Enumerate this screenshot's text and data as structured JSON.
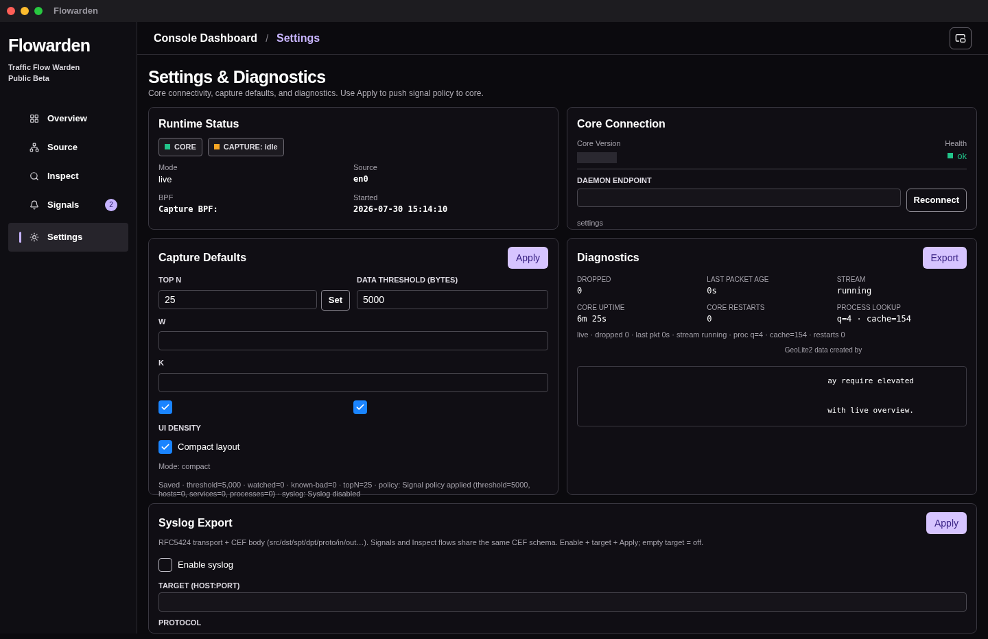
{
  "window": {
    "title": "Flowarden"
  },
  "sidebar": {
    "brand": "Flowarden",
    "tagline": "Traffic Flow Warden",
    "edition": "Public Beta",
    "items": [
      {
        "label": "Overview",
        "selected": false
      },
      {
        "label": "Source",
        "selected": false
      },
      {
        "label": "Inspect",
        "selected": false
      },
      {
        "label": "Signals",
        "selected": false,
        "badge": "2"
      },
      {
        "label": "Settings",
        "selected": true
      }
    ]
  },
  "breadcrumb": {
    "parent": "Console Dashboard",
    "separator": "/",
    "current": "Settings"
  },
  "page": {
    "title": "Settings & Diagnostics",
    "subtitle": "Core connectivity, capture defaults, and diagnostics. Use Apply to push signal policy to core."
  },
  "runtime_status": {
    "title": "Runtime Status",
    "badges": [
      {
        "label": "CORE",
        "color": "#22c48a"
      },
      {
        "label": "CAPTURE: idle",
        "color": "#f5a524"
      }
    ],
    "fields": [
      {
        "label": "Mode",
        "value": "live",
        "mono": false
      },
      {
        "label": "Source",
        "value": "en0",
        "mono": true
      },
      {
        "label": "BPF",
        "value": "Capture BPF:",
        "mono": true
      },
      {
        "label": "Started",
        "value": "2026-07-30 15:14:10",
        "mono": true
      }
    ]
  },
  "core_connection": {
    "title": "Core Connection",
    "version_label": "Core Version",
    "health_label": "Health",
    "health_value": "ok",
    "endpoint_label": "DAEMON ENDPOINT",
    "reconnect": "Reconnect",
    "note": "settings"
  },
  "capture_defaults": {
    "title": "Capture Defaults",
    "apply": "Apply",
    "top_n_label": "TOP N",
    "top_n_value": "25",
    "set": "Set",
    "threshold_label": "DATA THRESHOLD (BYTES)",
    "threshold_value": "5000",
    "field_3_label": "W",
    "field_4_label": "K",
    "hidden_checks": [
      {
        "checked": true
      },
      {
        "checked": true
      }
    ],
    "density_label": "UI DENSITY",
    "compact": {
      "label": "Compact layout",
      "checked": true
    },
    "mode": "Mode: compact",
    "saved": "Saved · threshold=5,000 · watched=0 · known-bad=0 · topN=25 · policy: Signal policy applied (threshold=5000, hosts=0, services=0, processes=0) · syslog: Syslog disabled"
  },
  "diagnostics": {
    "title": "Diagnostics",
    "export": "Export",
    "stats": [
      {
        "label": "DROPPED",
        "value": "0"
      },
      {
        "label": "LAST PACKET AGE",
        "value": "0s"
      },
      {
        "label": "STREAM",
        "value": "running"
      },
      {
        "label": "CORE UPTIME",
        "value": "6m 25s"
      },
      {
        "label": "CORE RESTARTS",
        "value": "0"
      },
      {
        "label": "PROCESS LOOKUP",
        "value": "q=4 · cache=154"
      }
    ],
    "summary": "live · dropped 0 · last pkt 0s · stream running · proc q=4 · cache=154 · restarts 0",
    "attribution": "GeoLite2 data created by",
    "log_lines": [
      "ay require elevated",
      "with live overview."
    ]
  },
  "syslog": {
    "title": "Syslog Export",
    "apply": "Apply",
    "description": "RFC5424 transport + CEF body (src/dst/spt/dpt/proto/in/out…). Signals and Inspect flows share the same CEF schema. Enable + target + Apply; empty target = off.",
    "enable": {
      "label": "Enable syslog",
      "checked": false
    },
    "target_label": "TARGET (HOST:PORT)",
    "protocol_label": "PROTOCOL"
  }
}
